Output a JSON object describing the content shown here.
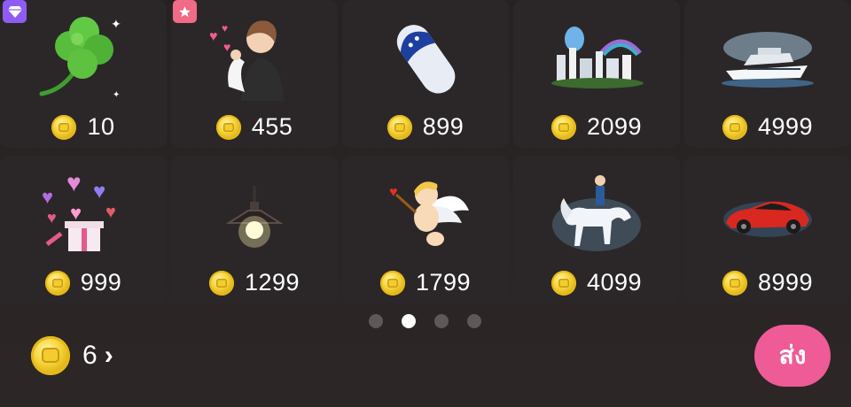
{
  "gifts": [
    {
      "name": "clover",
      "price": "10",
      "badge": "vip-diamond"
    },
    {
      "name": "boy-with-hearts",
      "price": "455",
      "badge": "star"
    },
    {
      "name": "slipper",
      "price": "899"
    },
    {
      "name": "city-skyline",
      "price": "2099"
    },
    {
      "name": "yacht",
      "price": "4999"
    },
    {
      "name": "heart-gift-box",
      "price": "999"
    },
    {
      "name": "hanging-lamp",
      "price": "1299"
    },
    {
      "name": "cupid",
      "price": "1799"
    },
    {
      "name": "white-horse-rider",
      "price": "4099"
    },
    {
      "name": "red-sports-car",
      "price": "8999"
    }
  ],
  "pagination": {
    "pages": 4,
    "active": 2
  },
  "balance": {
    "amount": "6",
    "chevron": "›"
  },
  "send_button": {
    "label": "ส่ง"
  },
  "colors": {
    "send": "#ee5b96",
    "vip_badge": "#8e5cf4",
    "star_badge": "#f06b86",
    "coin": "#f5d33a"
  }
}
